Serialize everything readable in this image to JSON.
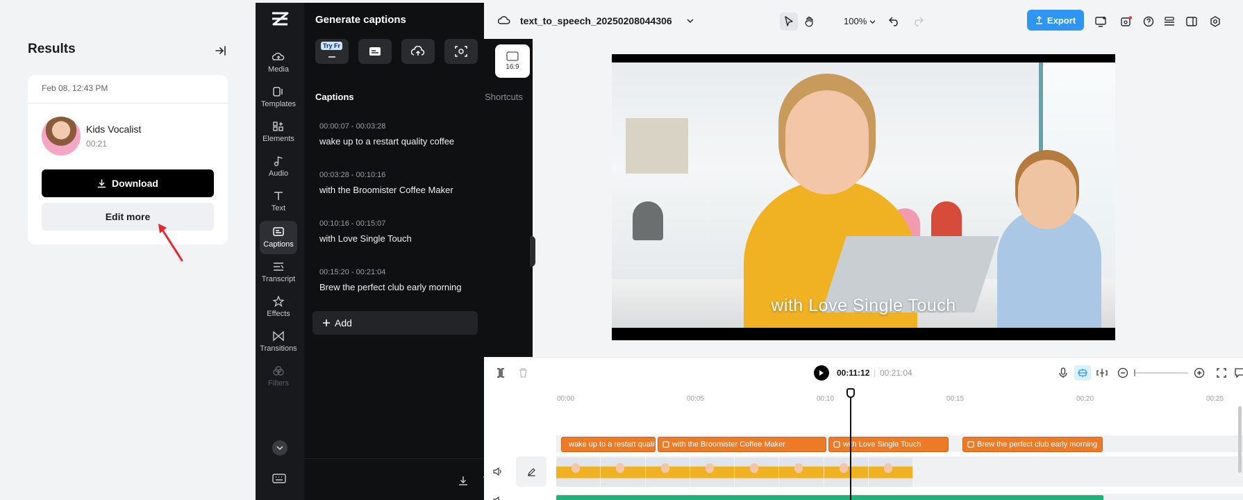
{
  "results": {
    "title": "Results",
    "date": "Feb 08, 12:43 PM",
    "voice_name": "Kids Vocalist",
    "voice_duration": "00:21",
    "download_label": "Download",
    "edit_more_label": "Edit more"
  },
  "nav": {
    "items": [
      {
        "label": "Media",
        "icon": "media-icon"
      },
      {
        "label": "Templates",
        "icon": "templates-icon"
      },
      {
        "label": "Elements",
        "icon": "elements-icon"
      },
      {
        "label": "Audio",
        "icon": "audio-icon"
      },
      {
        "label": "Text",
        "icon": "text-icon"
      },
      {
        "label": "Captions",
        "icon": "captions-icon"
      },
      {
        "label": "Transcript",
        "icon": "transcript-icon"
      },
      {
        "label": "Effects",
        "icon": "effects-icon"
      },
      {
        "label": "Transitions",
        "icon": "transitions-icon"
      },
      {
        "label": "Filters",
        "icon": "filters-icon"
      }
    ]
  },
  "captions_panel": {
    "title": "Generate captions",
    "try_free_badge": "Try Fr",
    "section_title": "Captions",
    "shortcuts_label": "Shortcuts",
    "add_label": "Add",
    "items": [
      {
        "time": "00:00:07 - 00:03:28",
        "text": "wake up to a restart quality coffee"
      },
      {
        "time": "00:03:28 - 00:10:16",
        "text": "with the Broomister Coffee Maker"
      },
      {
        "time": "00:10:16 - 00:15:07",
        "text": "with Love Single Touch"
      },
      {
        "time": "00:15:20 - 00:21:04",
        "text": "Brew the perfect club early morning"
      }
    ]
  },
  "topbar": {
    "project_name": "text_to_speech_20250208044306",
    "zoom": "100%",
    "export_label": "Export",
    "accent_color": "#2f95f2"
  },
  "canvas": {
    "ratio_label": "16:9",
    "subtitle": "with Love Single Touch"
  },
  "timeline": {
    "current_time": "00:11:12",
    "separator": "|",
    "total_time": "00:21:04",
    "ruler": [
      "00:00",
      "00:05",
      "00:10",
      "00:15",
      "00:20",
      "00:25"
    ],
    "caption_clips": [
      "wake up to a restart quality coffee",
      "with the Broomister Coffee Maker",
      "with Love Single Touch",
      "Brew the perfect club early morning"
    ],
    "caption_color": "#ec7a27",
    "audio_color": "#22b07d"
  }
}
